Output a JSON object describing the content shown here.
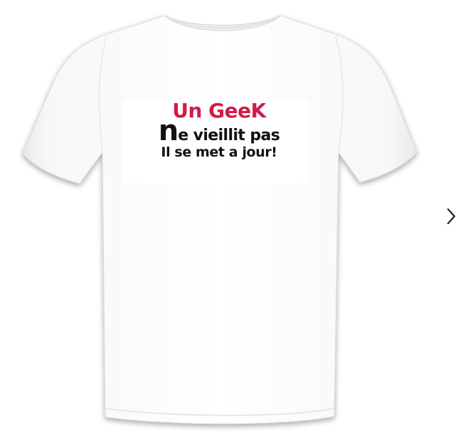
{
  "product": {
    "image_alt": "T-shirt blanc",
    "print_lines": {
      "line1": "Un GeeK",
      "line2_initial": "n",
      "line2_rest": "e vieillit pas",
      "line3": "Il se met a jour!"
    }
  },
  "colors": {
    "accent": "#d11a4b",
    "text": "#111111",
    "shirt": "#ffffff"
  },
  "navigation": {
    "next_icon": "chevron-right-icon"
  }
}
